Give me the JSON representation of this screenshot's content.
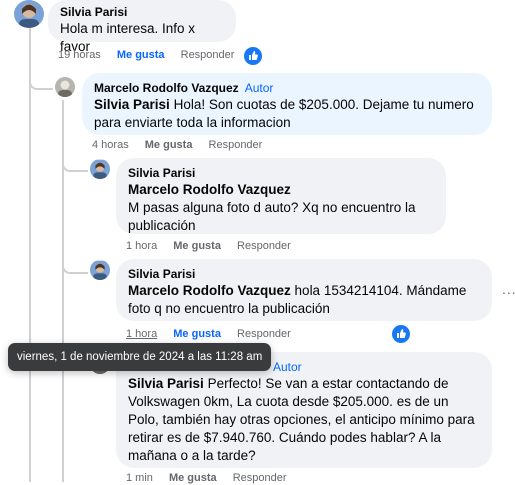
{
  "colors": {
    "accent": "#0866ff",
    "bubble": "#f0f2f5",
    "author_bubble": "#ebf5ff",
    "meta": "#65676b",
    "tooltip": "#3a3b3c"
  },
  "comments": [
    {
      "author": "Silvia Parisi",
      "text": "Hola m interesa. Info x favor",
      "time": "19 horas",
      "like": "Me gusta",
      "reply": "Responder",
      "liked": true
    },
    {
      "author": "Marcelo Rodolfo Vazquez",
      "badge": "Autor",
      "mention": "Silvia Parisi",
      "text": "Hola! Son cuotas de $205.000. Dejame tu numero para enviarte toda la informacion",
      "time": "4 horas",
      "like": "Me gusta",
      "reply": "Responder"
    },
    {
      "author": "Silvia Parisi",
      "mention": "Marcelo Rodolfo Vazquez",
      "text": "M pasas alguna foto d auto? Xq no encuentro la publicación",
      "time": "1 hora",
      "like": "Me gusta",
      "reply": "Responder"
    },
    {
      "author": "Silvia Parisi",
      "mention": "Marcelo Rodolfo Vazquez",
      "text": "hola 1534214104. Mándame foto q no encuentro la publicación",
      "time": "1 hora",
      "like": "Me gusta",
      "reply": "Responder",
      "liked": true
    },
    {
      "badge": "Autor",
      "mention": "Silvia Parisi",
      "text": "Perfecto! Se van a estar contactando de Volkswagen 0km, La cuota desde $205.000. es de un Polo, también hay otras opciones, el anticipo mínimo para retirar es de $7.940.760. Cuándo podes hablar? A la mañana o a la tarde?",
      "time": "1 min",
      "like": "Me gusta",
      "reply": "Responder"
    }
  ],
  "more_menu": "...",
  "tooltip": "viernes, 1 de noviembre de 2024 a las 11:28 am"
}
